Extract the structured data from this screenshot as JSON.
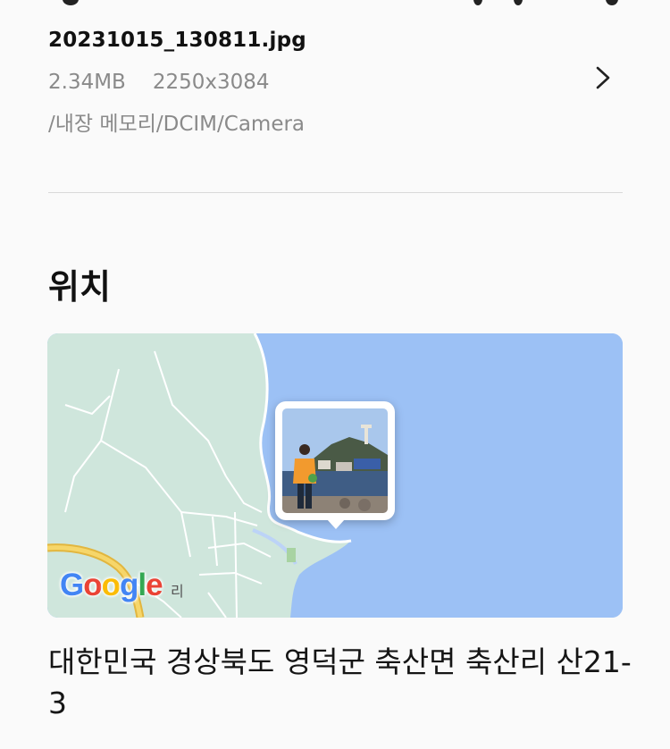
{
  "file": {
    "name": "20231015_130811.jpg",
    "size": "2.34MB",
    "resolution": "2250x3084",
    "path": "/내장 메모리/DCIM/Camera"
  },
  "location": {
    "section_title": "위치",
    "map_place_label": "리",
    "google_logo": "Google",
    "address": "대한민국 경상북도 영덕군 축산면 축산리 산21-3"
  },
  "colors": {
    "sea": "#9cc1f5",
    "land": "#cfe6dc",
    "divider": "#d9d9d9"
  }
}
